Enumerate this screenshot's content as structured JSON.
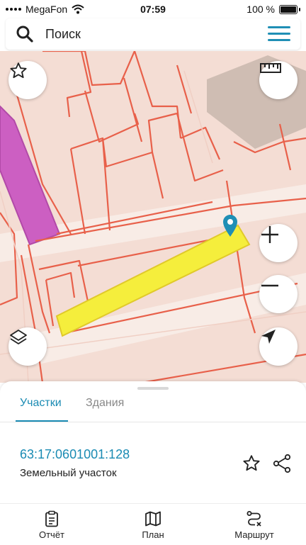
{
  "status_bar": {
    "carrier": "MegaFon",
    "time": "07:59",
    "battery": "100 %"
  },
  "search": {
    "placeholder": "Поиск"
  },
  "map": {
    "colors": {
      "background": "#f4ddd4",
      "parcel_border": "#e8604a",
      "selected_parcel": "#f5ee3c",
      "magenta_zone": "#cc5fc2",
      "building": "#cfbdb3",
      "marker": "#1f8fb5"
    },
    "controls": {
      "favorite_icon": "star-icon",
      "ruler_icon": "ruler-icon",
      "zoom_in_icon": "plus-icon",
      "zoom_out_icon": "minus-icon",
      "layers_icon": "layers-icon",
      "locate_icon": "navigation-arrow-icon"
    }
  },
  "sheet": {
    "tabs": [
      {
        "label": "Участки",
        "active": true
      },
      {
        "label": "Здания",
        "active": false
      }
    ],
    "parcel": {
      "cadastral_number": "63:17:0601001:128",
      "type": "Земельный участок"
    }
  },
  "bottom_nav": {
    "items": [
      {
        "label": "Отчёт",
        "icon": "clipboard-icon"
      },
      {
        "label": "План",
        "icon": "map-icon"
      },
      {
        "label": "Маршрут",
        "icon": "route-icon"
      }
    ]
  }
}
